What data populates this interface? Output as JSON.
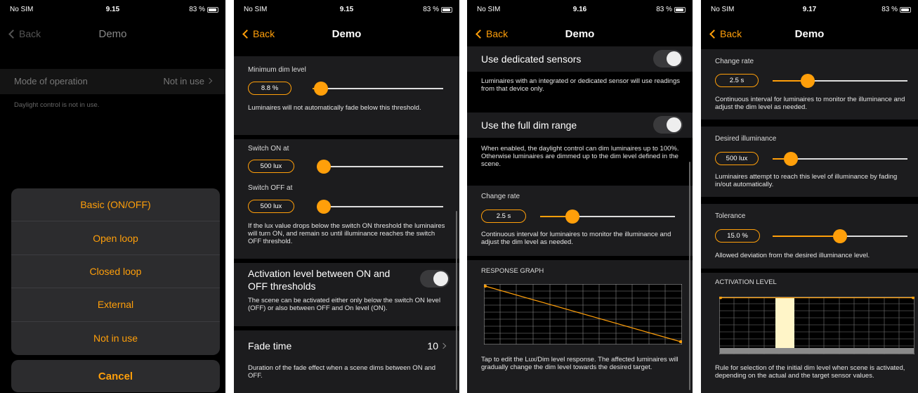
{
  "status": {
    "carrier": "No SIM",
    "battery": "83 %"
  },
  "colors": {
    "accent": "#ff9f0a",
    "background": "#000000",
    "cell": "#1c1c1e"
  },
  "screen1": {
    "time": "9.15",
    "back": "Back",
    "title": "Demo",
    "mode_label": "Mode of operation",
    "mode_value": "Not in use",
    "mode_desc": "Daylight control is not in use.",
    "options": [
      "Basic (ON/OFF)",
      "Open loop",
      "Closed loop",
      "External",
      "Not in use"
    ],
    "cancel": "Cancel"
  },
  "screen2": {
    "time": "9.15",
    "back": "Back",
    "title": "Demo",
    "min_dim_label": "Minimum dim level",
    "min_dim_value": "8.8 %",
    "min_dim_level": 0.06,
    "min_dim_desc": "Luminaires will not automatically fade below this threshold.",
    "switch_on_label": "Switch ON at",
    "switch_on_value": "500 lux",
    "switch_off_label": "Switch OFF at",
    "switch_off_value": "500 lux",
    "switch_desc": "If the lux value drops below the switch ON threshold the luminaires will turn ON, and remain so until illuminance reaches the switch OFF threshold.",
    "activation_label": "Activation level between ON and OFF thresholds",
    "activation_desc": "The scene can be activated either only below the switch ON level (OFF) or also between OFF and On level (ON).",
    "fade_label": "Fade time",
    "fade_value": "10",
    "fade_desc": "Duration of the fade effect when a scene dims between ON and OFF."
  },
  "screen3": {
    "time": "9.16",
    "back": "Back",
    "title": "Demo",
    "dedicated_label": "Use dedicated sensors",
    "dedicated_desc": "Luminaires with an integrated or dedicated sensor will use readings from that device only.",
    "full_dim_label": "Use the full dim range",
    "full_dim_desc": "When enabled, the daylight control can dim luminaires up to 100%. Otherwise luminaires are dimmed up to the dim level defined in the scene.",
    "change_rate_label": "Change rate",
    "change_rate_value": "2.5 s",
    "change_rate_desc": "Continuous interval for luminaires to monitor the illuminance and adjust the dim level as needed.",
    "graph_header": "RESPONSE GRAPH",
    "graph_desc": "Tap to edit the Lux/Dim level response. The affected luminaires will gradually change the dim level towards the desired target."
  },
  "screen4": {
    "time": "9.17",
    "back": "Back",
    "title": "Demo",
    "change_rate_label": "Change rate",
    "change_rate_value": "2.5 s",
    "change_rate_desc": "Continuous interval for luminaires to monitor the illuminance and adjust the dim level as needed.",
    "desired_label": "Desired illuminance",
    "desired_value": "500 lux",
    "desired_desc": "Luminaires attempt to reach this level of illuminance by fading in/out automatically.",
    "tolerance_label": "Tolerance",
    "tolerance_value": "15.0 %",
    "tolerance_desc": "Allowed deviation from the desired illuminance level.",
    "activation_header": "ACTIVATION LEVEL",
    "activation_desc": "Rule for selection of the initial dim level when scene is activated, depending on the actual and the target sensor values."
  }
}
